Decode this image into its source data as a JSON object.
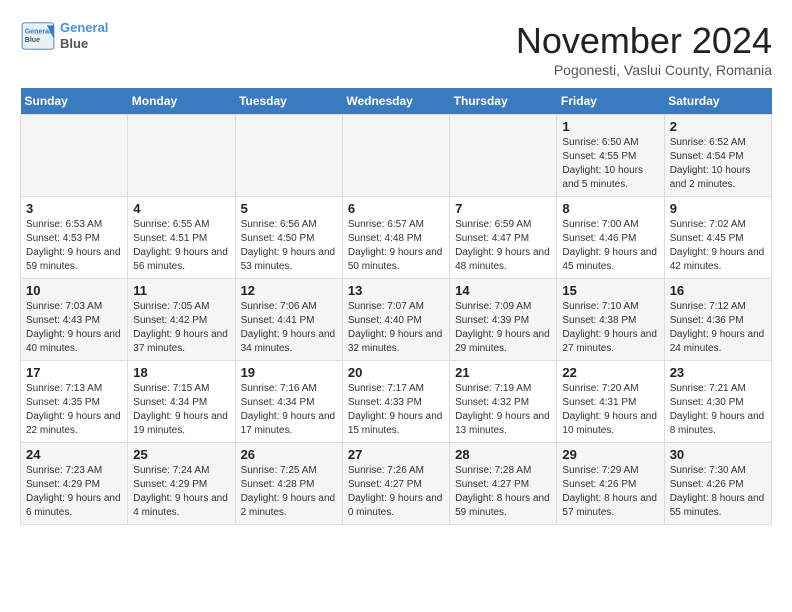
{
  "header": {
    "logo_line1": "General",
    "logo_line2": "Blue",
    "month_title": "November 2024",
    "subtitle": "Pogonesti, Vaslui County, Romania"
  },
  "weekdays": [
    "Sunday",
    "Monday",
    "Tuesday",
    "Wednesday",
    "Thursday",
    "Friday",
    "Saturday"
  ],
  "weeks": [
    [
      {
        "day": "",
        "info": ""
      },
      {
        "day": "",
        "info": ""
      },
      {
        "day": "",
        "info": ""
      },
      {
        "day": "",
        "info": ""
      },
      {
        "day": "",
        "info": ""
      },
      {
        "day": "1",
        "info": "Sunrise: 6:50 AM\nSunset: 4:55 PM\nDaylight: 10 hours and 5 minutes."
      },
      {
        "day": "2",
        "info": "Sunrise: 6:52 AM\nSunset: 4:54 PM\nDaylight: 10 hours and 2 minutes."
      }
    ],
    [
      {
        "day": "3",
        "info": "Sunrise: 6:53 AM\nSunset: 4:53 PM\nDaylight: 9 hours and 59 minutes."
      },
      {
        "day": "4",
        "info": "Sunrise: 6:55 AM\nSunset: 4:51 PM\nDaylight: 9 hours and 56 minutes."
      },
      {
        "day": "5",
        "info": "Sunrise: 6:56 AM\nSunset: 4:50 PM\nDaylight: 9 hours and 53 minutes."
      },
      {
        "day": "6",
        "info": "Sunrise: 6:57 AM\nSunset: 4:48 PM\nDaylight: 9 hours and 50 minutes."
      },
      {
        "day": "7",
        "info": "Sunrise: 6:59 AM\nSunset: 4:47 PM\nDaylight: 9 hours and 48 minutes."
      },
      {
        "day": "8",
        "info": "Sunrise: 7:00 AM\nSunset: 4:46 PM\nDaylight: 9 hours and 45 minutes."
      },
      {
        "day": "9",
        "info": "Sunrise: 7:02 AM\nSunset: 4:45 PM\nDaylight: 9 hours and 42 minutes."
      }
    ],
    [
      {
        "day": "10",
        "info": "Sunrise: 7:03 AM\nSunset: 4:43 PM\nDaylight: 9 hours and 40 minutes."
      },
      {
        "day": "11",
        "info": "Sunrise: 7:05 AM\nSunset: 4:42 PM\nDaylight: 9 hours and 37 minutes."
      },
      {
        "day": "12",
        "info": "Sunrise: 7:06 AM\nSunset: 4:41 PM\nDaylight: 9 hours and 34 minutes."
      },
      {
        "day": "13",
        "info": "Sunrise: 7:07 AM\nSunset: 4:40 PM\nDaylight: 9 hours and 32 minutes."
      },
      {
        "day": "14",
        "info": "Sunrise: 7:09 AM\nSunset: 4:39 PM\nDaylight: 9 hours and 29 minutes."
      },
      {
        "day": "15",
        "info": "Sunrise: 7:10 AM\nSunset: 4:38 PM\nDaylight: 9 hours and 27 minutes."
      },
      {
        "day": "16",
        "info": "Sunrise: 7:12 AM\nSunset: 4:36 PM\nDaylight: 9 hours and 24 minutes."
      }
    ],
    [
      {
        "day": "17",
        "info": "Sunrise: 7:13 AM\nSunset: 4:35 PM\nDaylight: 9 hours and 22 minutes."
      },
      {
        "day": "18",
        "info": "Sunrise: 7:15 AM\nSunset: 4:34 PM\nDaylight: 9 hours and 19 minutes."
      },
      {
        "day": "19",
        "info": "Sunrise: 7:16 AM\nSunset: 4:34 PM\nDaylight: 9 hours and 17 minutes."
      },
      {
        "day": "20",
        "info": "Sunrise: 7:17 AM\nSunset: 4:33 PM\nDaylight: 9 hours and 15 minutes."
      },
      {
        "day": "21",
        "info": "Sunrise: 7:19 AM\nSunset: 4:32 PM\nDaylight: 9 hours and 13 minutes."
      },
      {
        "day": "22",
        "info": "Sunrise: 7:20 AM\nSunset: 4:31 PM\nDaylight: 9 hours and 10 minutes."
      },
      {
        "day": "23",
        "info": "Sunrise: 7:21 AM\nSunset: 4:30 PM\nDaylight: 9 hours and 8 minutes."
      }
    ],
    [
      {
        "day": "24",
        "info": "Sunrise: 7:23 AM\nSunset: 4:29 PM\nDaylight: 9 hours and 6 minutes."
      },
      {
        "day": "25",
        "info": "Sunrise: 7:24 AM\nSunset: 4:29 PM\nDaylight: 9 hours and 4 minutes."
      },
      {
        "day": "26",
        "info": "Sunrise: 7:25 AM\nSunset: 4:28 PM\nDaylight: 9 hours and 2 minutes."
      },
      {
        "day": "27",
        "info": "Sunrise: 7:26 AM\nSunset: 4:27 PM\nDaylight: 9 hours and 0 minutes."
      },
      {
        "day": "28",
        "info": "Sunrise: 7:28 AM\nSunset: 4:27 PM\nDaylight: 8 hours and 59 minutes."
      },
      {
        "day": "29",
        "info": "Sunrise: 7:29 AM\nSunset: 4:26 PM\nDaylight: 8 hours and 57 minutes."
      },
      {
        "day": "30",
        "info": "Sunrise: 7:30 AM\nSunset: 4:26 PM\nDaylight: 8 hours and 55 minutes."
      }
    ]
  ]
}
